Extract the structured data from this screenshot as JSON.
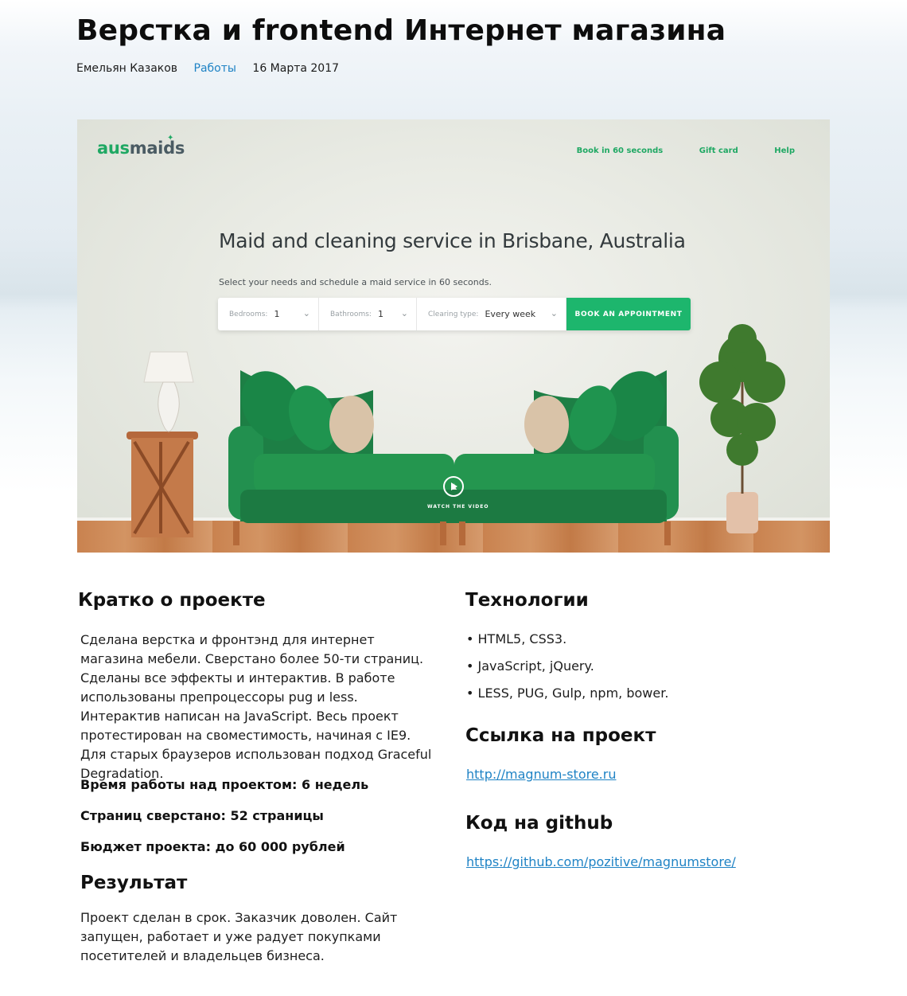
{
  "post": {
    "title": "Верстка и frontend Интернет магазина",
    "author": "Емельян Казаков",
    "category": "Работы",
    "date": "16 Марта 2017"
  },
  "hero": {
    "logo_part1": "aus",
    "logo_part2": "maids",
    "nav": [
      "Book in 60 seconds",
      "Gift card",
      "Help"
    ],
    "headline": "Maid and cleaning service in Brisbane, Australia",
    "subheadline": "Select your needs and schedule a maid service in 60 seconds.",
    "form": {
      "bedrooms_label": "Bedrooms:",
      "bedrooms_value": "1",
      "bathrooms_label": "Bathrooms:",
      "bathrooms_value": "1",
      "clearing_label": "Clearing type:",
      "clearing_value": "Every week",
      "button_label": "BOOK AN APPOINTMENT"
    },
    "watch_label": "WATCH THE VIDEO",
    "colors": {
      "brand_green": "#1db66d",
      "logo_gray": "#4a5b63",
      "sofa_green": "#1f8a4a"
    }
  },
  "about": {
    "heading": "Кратко о проекте",
    "description": "Сделана верстка и фронтэнд для интернет магазина мебели. Сверстано более 50-ти страниц. Сделаны все эффекты и интерактив. В работе использованы препроцессоры pug и less. Интерактив написан на JavaScript. Весь проект протестирован на свомеcтимость, начиная с IE9. Для старых браузеров использован подход Graceful Degradation.",
    "work_time": "Время работы над проектом: 6 недель",
    "pages_count": "Страниц сверстано: 52 страницы",
    "budget": "Бюджет проекта: до 60 000 рублей"
  },
  "result": {
    "heading": "Результат",
    "text": "Проект сделан в срок. Заказчик доволен. Сайт запущен, работает и уже радует покупками посетителей и владельцев бизнеса."
  },
  "tech": {
    "heading": "Технологии",
    "items": [
      "• HTML5, CSS3.",
      "• JavaScript, jQuery.",
      "• LESS, PUG, Gulp, npm, bower."
    ]
  },
  "project_link": {
    "heading": "Ссылка на проект",
    "url": "http://magnum-store.ru"
  },
  "github": {
    "heading": "Код на github",
    "url": "https://github.com/pozitive/magnumstore/"
  },
  "colors": {
    "link": "#1f83c5",
    "text": "#111111"
  }
}
